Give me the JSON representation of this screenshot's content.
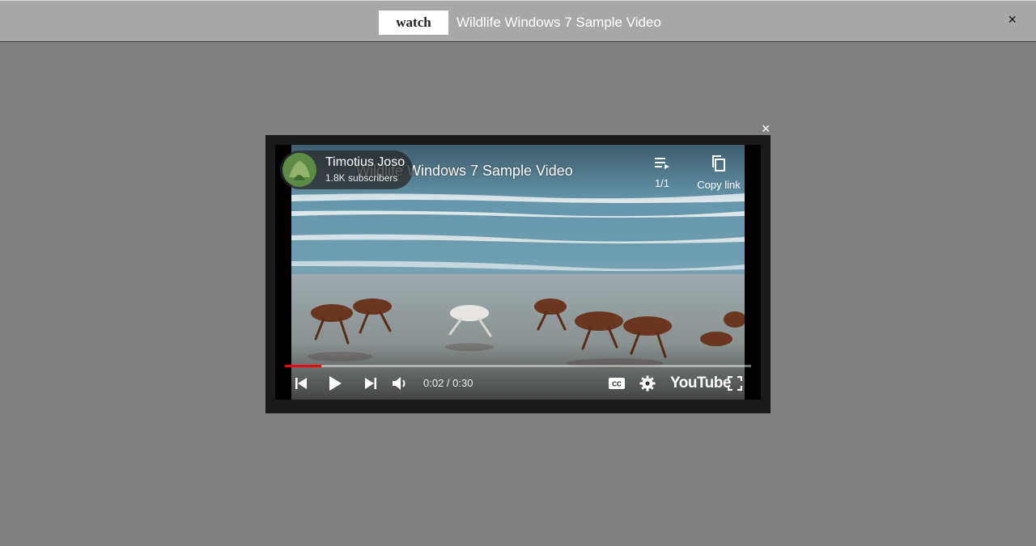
{
  "topbar": {
    "watch_label": "watch",
    "title": "Wildlife Windows 7 Sample Video",
    "close_glyph": "×"
  },
  "modal": {
    "close_glyph": "×"
  },
  "player": {
    "video_title": "Wildlife Windows 7 Sample Video",
    "channel": {
      "name": "Timotius Joso",
      "subscribers": "1.8K subscribers"
    },
    "playlist_count": "1/1",
    "copy_link_label": "Copy link",
    "time": "0:02 / 0:30",
    "progress_fraction": 0.078,
    "logo_text": "YouTube",
    "icons": {
      "playlist": "playlist-icon",
      "copy": "copy-icon",
      "previous": "previous-icon",
      "play": "play-icon",
      "next": "next-icon",
      "volume": "volume-icon",
      "captions": "captions-icon",
      "settings": "gear-icon",
      "fullscreen": "fullscreen-icon"
    }
  },
  "colors": {
    "page_background": "#808080",
    "topbar_background": "#a8a8a8",
    "modal_frame": "#1a1a1a",
    "progress_played": "#ff0000"
  }
}
